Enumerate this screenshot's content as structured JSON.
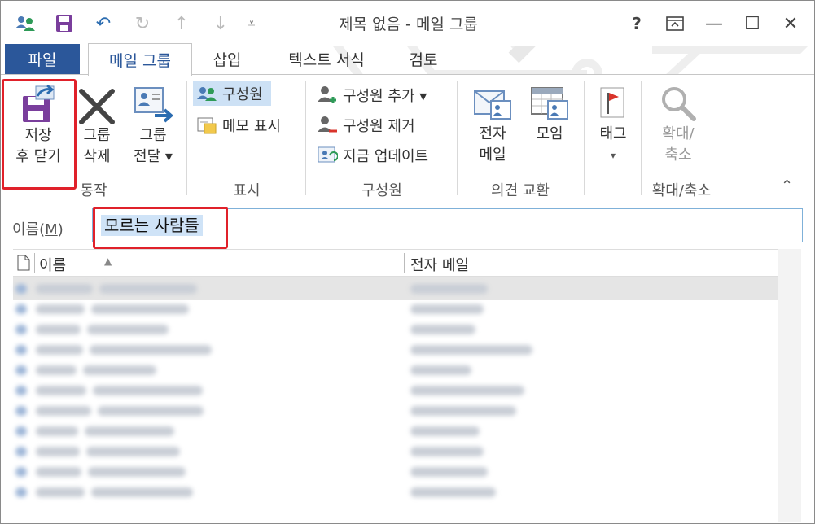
{
  "window": {
    "title": "제목 없음 - 메일 그룹",
    "help": "?",
    "restore_icon": "ribbon-display-icon",
    "minimize": "—",
    "maximize": "☐",
    "close": "✕"
  },
  "qat": {
    "undo": "↶",
    "redo": "↻",
    "up": "↑",
    "down": "↓",
    "more": "⩡"
  },
  "tabs": {
    "file": "파일",
    "items": [
      "메일 그룹",
      "삽입",
      "텍스트 서식",
      "검토"
    ]
  },
  "ribbon": {
    "actions": {
      "save_close_line1": "저장",
      "save_close_line2": "후 닫기",
      "delete_line1": "그룹",
      "delete_line2": "삭제",
      "forward_line1": "그룹",
      "forward_line2": "전달 ▾",
      "group_label": "동작"
    },
    "show": {
      "members": "구성원",
      "notes": "메모 표시",
      "group_label": "표시"
    },
    "members": {
      "add": "구성원 추가 ▾",
      "remove": "구성원 제거",
      "update": "지금 업데이트",
      "group_label": "구성원"
    },
    "communicate": {
      "email_line1": "전자",
      "email_line2": "메일",
      "meeting": "모임",
      "group_label": "의견 교환"
    },
    "tags": {
      "tag": "태그",
      "dropdown": "▾"
    },
    "zoom": {
      "zoom_line1": "확대/",
      "zoom_line2": "축소",
      "group_label": "확대/축소"
    },
    "collapse": "⌃"
  },
  "name_field": {
    "label_prefix": "이름(",
    "label_key": "M",
    "label_suffix": ")",
    "value": "모르는 사람들"
  },
  "list": {
    "col_name": "이름",
    "col_email": "전자 메일",
    "sort_icon": "▲",
    "rows": 11
  },
  "colors": {
    "accent": "#2b579a",
    "highlight": "#e0212a",
    "selection": "#cfe3f7"
  }
}
